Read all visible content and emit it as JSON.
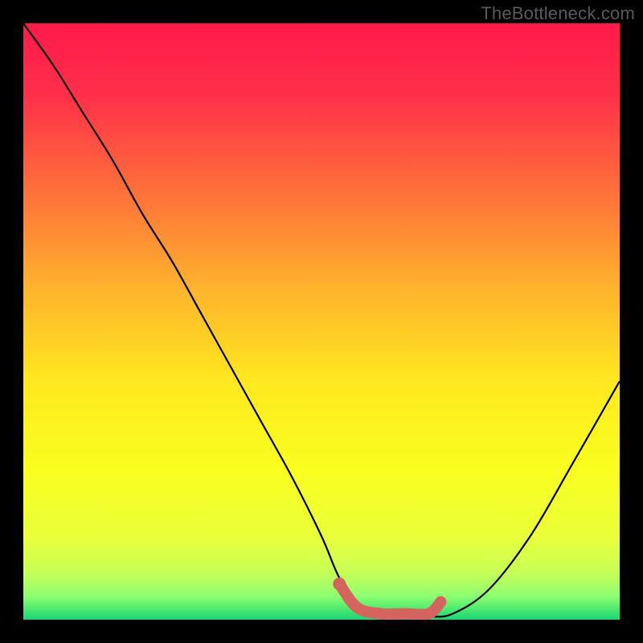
{
  "watermark": "TheBottleneck.com",
  "chart_data": {
    "type": "line",
    "title": "",
    "xlabel": "",
    "ylabel": "",
    "xlim": [
      0,
      100
    ],
    "ylim": [
      0,
      100
    ],
    "series": [
      {
        "name": "bottleneck-curve",
        "x": [
          0,
          5,
          10,
          15,
          20,
          25,
          30,
          35,
          40,
          45,
          50,
          53,
          56,
          60,
          64,
          68,
          72,
          78,
          85,
          92,
          100
        ],
        "y": [
          100,
          93,
          85,
          77,
          68,
          60,
          51,
          42,
          33,
          24,
          14,
          7,
          3,
          1,
          0.5,
          0.5,
          1,
          5,
          14,
          26,
          40
        ]
      },
      {
        "name": "optimal-marker",
        "x": [
          53,
          56,
          60,
          64,
          68,
          70
        ],
        "y": [
          6,
          2,
          1,
          1,
          1,
          3
        ]
      }
    ],
    "gradient_stops": [
      {
        "offset": 0.0,
        "color": "#ff1a4b"
      },
      {
        "offset": 0.12,
        "color": "#ff2f4a"
      },
      {
        "offset": 0.28,
        "color": "#ff6f3a"
      },
      {
        "offset": 0.45,
        "color": "#ffb52c"
      },
      {
        "offset": 0.6,
        "color": "#ffe81f"
      },
      {
        "offset": 0.75,
        "color": "#f9ff1f"
      },
      {
        "offset": 0.86,
        "color": "#eaff3a"
      },
      {
        "offset": 0.92,
        "color": "#c7ff55"
      },
      {
        "offset": 0.96,
        "color": "#8fff70"
      },
      {
        "offset": 1.0,
        "color": "#1bd672"
      }
    ],
    "marker_color": "#d5645e",
    "curve_color": "#000000"
  }
}
